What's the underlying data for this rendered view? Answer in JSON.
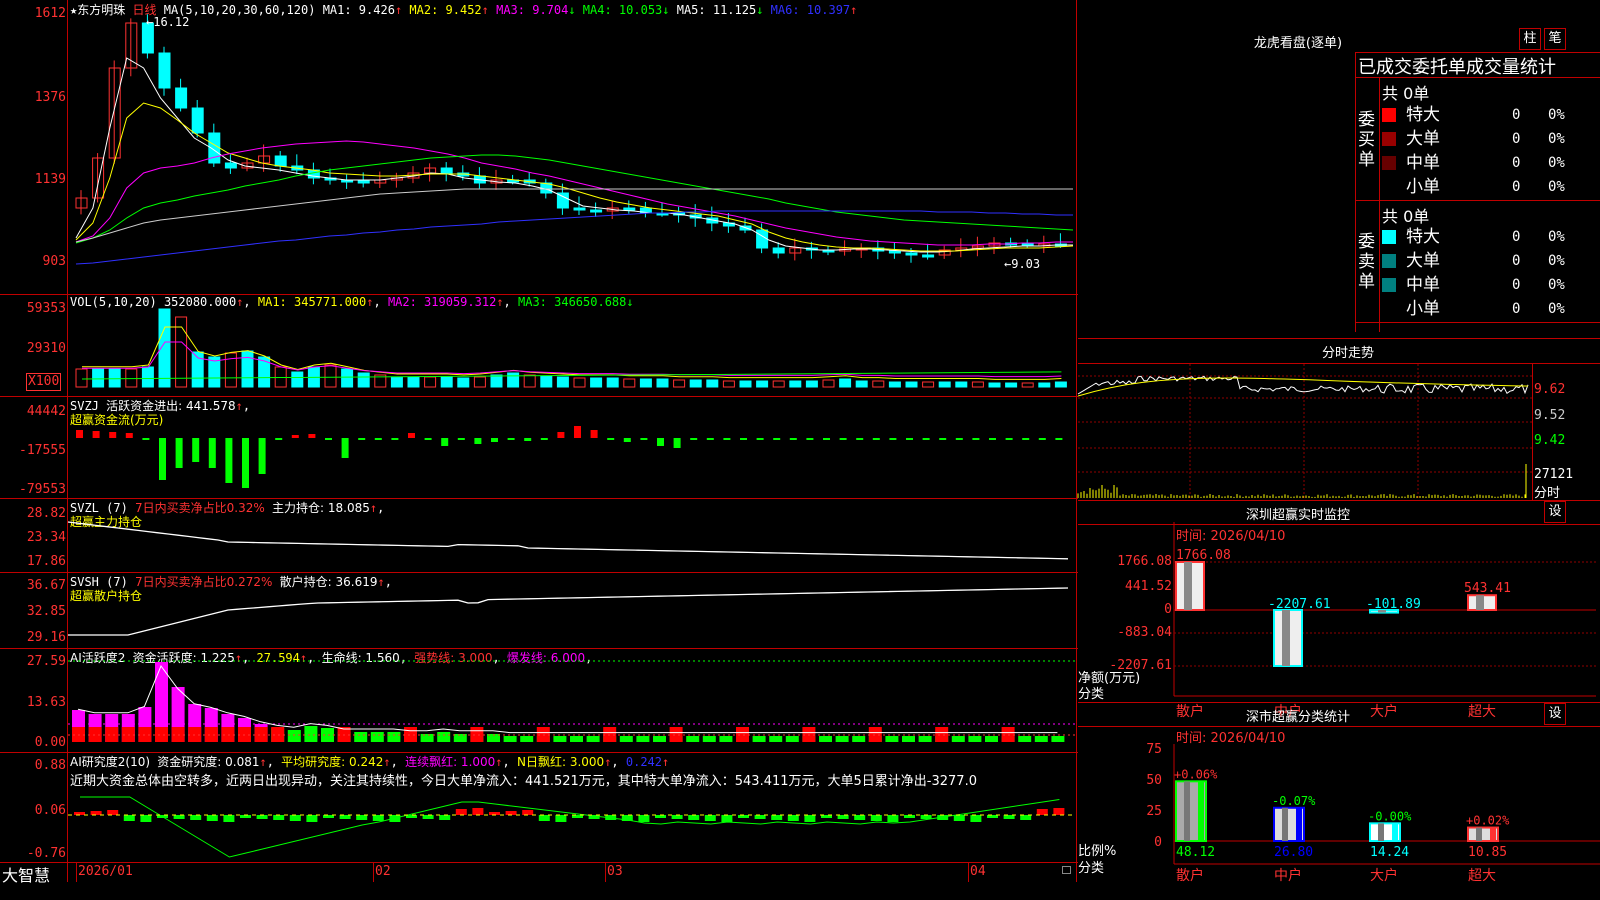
{
  "stock": {
    "name": "东方明珠",
    "period": "日线",
    "star": "★"
  },
  "main": {
    "ma_label": "MA(5,10,20,30,60,120)",
    "ma": [
      {
        "label": "MA1:",
        "value": "9.426",
        "arrow": "↑",
        "color": "#ffffff"
      },
      {
        "label": "MA2:",
        "value": "9.452",
        "arrow": "↑",
        "color": "#ffff00"
      },
      {
        "label": "MA3:",
        "value": "9.704",
        "arrow": "↓",
        "color": "#ff00ff"
      },
      {
        "label": "MA4:",
        "value": "10.053",
        "arrow": "↓",
        "color": "#00ff00"
      },
      {
        "label": "MA5:",
        "value": "11.125",
        "arrow": "↓",
        "color": "#ffffff"
      },
      {
        "label": "MA6:",
        "value": "10.397",
        "arrow": "↑",
        "color": "#3030ff"
      }
    ],
    "axis": [
      "1612",
      "1376",
      "1139",
      "903"
    ],
    "high_label": "16.12",
    "low_label": "9.03"
  },
  "vol": {
    "label": "VOL(5,10,20)",
    "value": "352080.000",
    "ma1": "MA1: 345771.000",
    "ma2": "MA2: 319059.312",
    "ma3": "MA3: 346650.688",
    "axis": [
      "59353",
      "29310"
    ],
    "unit": "X100"
  },
  "svzj": {
    "label": "SVZJ",
    "title": "活跃资金进出: 441.578",
    "sub": "超赢资金流(万元)",
    "axis": [
      "44442",
      "-17555",
      "-79553"
    ]
  },
  "svzl": {
    "label": "SVZL (7)",
    "ratio": "7日内买卖净占比0.32%",
    "hold": "主力持仓: 18.085",
    "sub": "超赢主力持仓",
    "axis": [
      "28.82",
      "23.34",
      "17.86"
    ]
  },
  "svsh": {
    "label": "SVSH (7)",
    "ratio": "7日内买卖净占比0.272%",
    "hold": "散户持仓: 36.619",
    "sub": "超赢散户持仓",
    "axis": [
      "36.67",
      "32.85",
      "29.16"
    ]
  },
  "ai1": {
    "label": "AI活跃度2",
    "a": "资金活跃度: 1.225",
    "b": "27.594",
    "c": "生命线: 1.560",
    "d": "强势线: 3.000",
    "e": "爆发线: 6.000",
    "axis": [
      "27.59",
      "13.63",
      "0.00"
    ]
  },
  "ai2": {
    "label": "AI研究度2(10)",
    "a": "资金研究度: 0.081",
    "b": "平均研究度: 0.242",
    "c": "连续飘红: 1.000",
    "d": "N日飘红: 3.000",
    "e": "0.242",
    "text": "近期大资金总体由空转多，近两日出现异动，关注其持续性，今日大单净流入：441.521万元，其中特大单净流入：543.411万元，大单5日累计净出-3277.0",
    "axis": [
      "0.88",
      "0.06",
      "-0.76"
    ]
  },
  "xaxis": {
    "brand": "大智慧",
    "labels": [
      "2026/01",
      "02",
      "03",
      "04"
    ]
  },
  "lhb": {
    "title": "龙虎看盘(逐单)",
    "btn1": "柱",
    "btn2": "笔",
    "header": "已成交委托单成交量统计",
    "buy_label": "委买单",
    "sell_label": "委卖单",
    "buy_total": "共 0单",
    "sell_total": "共 0单",
    "buy_rows": [
      {
        "name": "特大",
        "qty": "0",
        "pct": "0%",
        "color": "#ff0000"
      },
      {
        "name": "大单",
        "qty": "0",
        "pct": "0%",
        "color": "#990000"
      },
      {
        "name": "中单",
        "qty": "0",
        "pct": "0%",
        "color": "#660000"
      },
      {
        "name": "小单",
        "qty": "0",
        "pct": "0%",
        "color": ""
      }
    ],
    "sell_rows": [
      {
        "name": "特大",
        "qty": "0",
        "pct": "0%",
        "color": "#00ffff"
      },
      {
        "name": "大单",
        "qty": "0",
        "pct": "0%",
        "color": "#008080"
      },
      {
        "name": "中单",
        "qty": "0",
        "pct": "0%",
        "color": "#008080"
      },
      {
        "name": "小单",
        "qty": "0",
        "pct": "0%",
        "color": ""
      }
    ]
  },
  "intraday": {
    "title": "分时走势",
    "axis": [
      "9.62",
      "9.52",
      "9.42"
    ],
    "vol": "27121",
    "vol_label": "分时"
  },
  "monitor": {
    "title": "深圳超赢实时监控",
    "btn": "设",
    "time": "时间: 2026/04/10",
    "axis": [
      "1766.08",
      "441.52",
      "0",
      "-883.04",
      "-2207.61"
    ],
    "ylabel": "净额(万元)",
    "xlabel": "分类",
    "cats": [
      "散户",
      "中户",
      "大户",
      "超大"
    ],
    "values": [
      "1766.08",
      "-2207.61",
      "-101.89",
      "543.41"
    ]
  },
  "classify": {
    "title": "深市超赢分类统计",
    "btn": "设",
    "time": "时间: 2026/04/10",
    "axis": [
      "75",
      "50",
      "25",
      "0"
    ],
    "ylabel": "比例%",
    "xlabel": "分类",
    "cats": [
      "散户",
      "中户",
      "大户",
      "超大"
    ],
    "values": [
      "48.12",
      "26.80",
      "14.24",
      "10.85"
    ],
    "changes": [
      "+0.06%",
      "-0.07%",
      "-0.00%",
      "+0.02%"
    ]
  }
}
